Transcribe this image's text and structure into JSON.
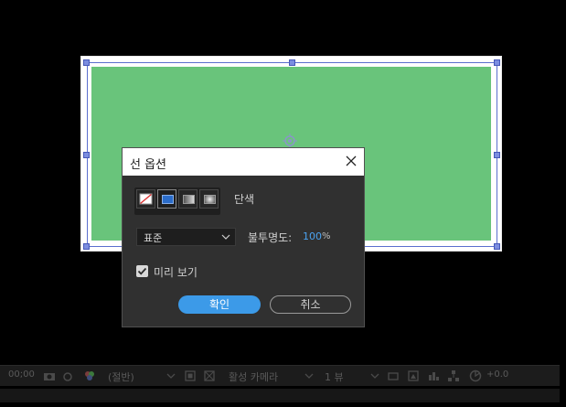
{
  "dialog": {
    "title": "선 옵션",
    "fill_type_label": "단색",
    "blend_mode": "표준",
    "opacity_label": "불투명도:",
    "opacity_value": "100",
    "opacity_unit": "%",
    "preview_label": "미리 보기",
    "preview_checked": true,
    "ok_label": "확인",
    "cancel_label": "취소",
    "swatches": [
      "none-icon",
      "solid-color-icon",
      "linear-gradient-icon",
      "radial-gradient-icon"
    ]
  },
  "viewer_bar": {
    "timecode": "00;00",
    "resolution": "(절반)",
    "camera": "활성 카메라",
    "views": "1 뷰",
    "exposure": "+0.0"
  },
  "colors": {
    "shape_fill": "#69c47b",
    "accent": "#3c9ae8",
    "opacity_value": "#4ba3f0"
  }
}
